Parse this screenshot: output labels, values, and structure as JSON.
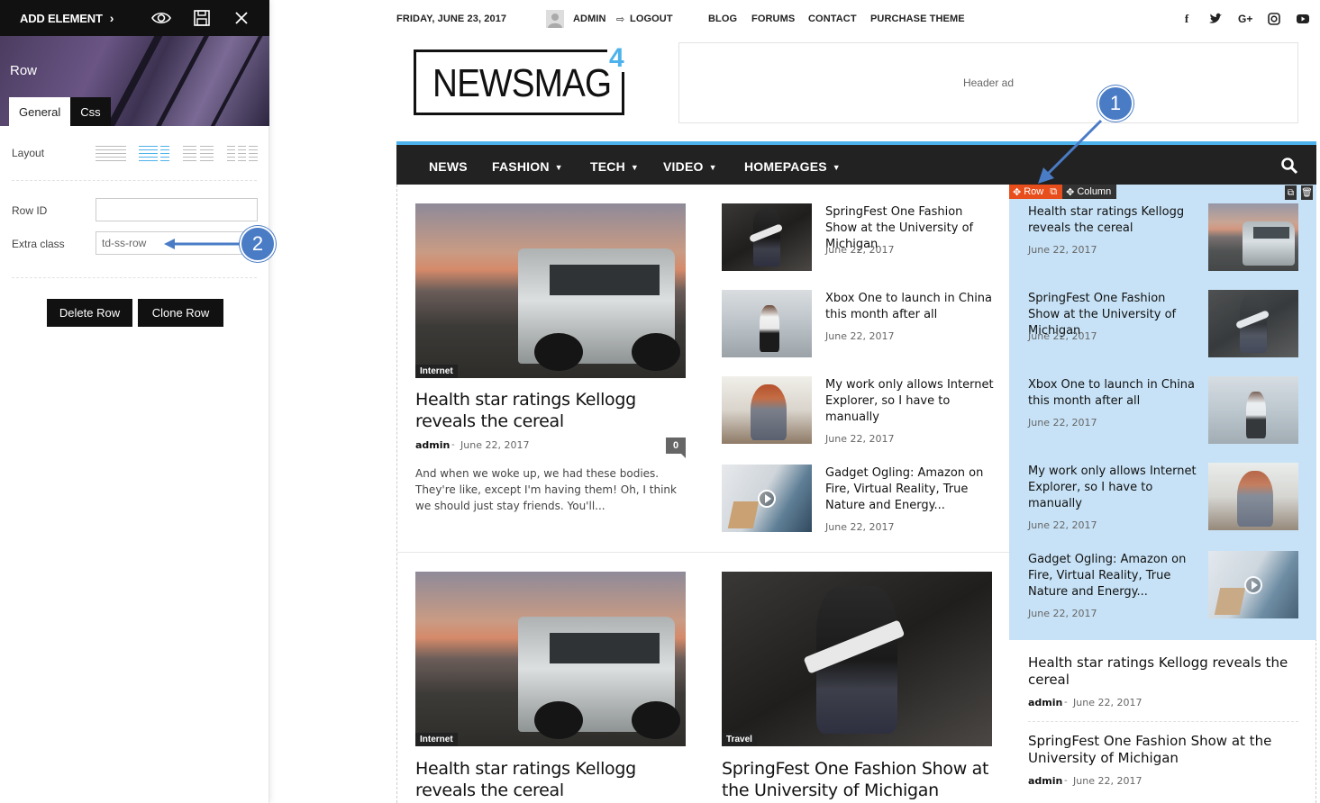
{
  "editor": {
    "add_element": "ADD ELEMENT",
    "title": "Row",
    "tabs": [
      "General",
      "Css"
    ],
    "layout_label": "Layout",
    "row_id_label": "Row ID",
    "row_id_value": "",
    "extra_class_label": "Extra class",
    "extra_class_value": "td-ss-row",
    "delete_button": "Delete Row",
    "clone_button": "Clone Row",
    "accent_color": "#4a7cc6"
  },
  "callouts": [
    "1",
    "2"
  ],
  "site": {
    "date": "FRIDAY, JUNE 23, 2017",
    "user": "ADMIN",
    "logout": "LOGOUT",
    "top_links": [
      "BLOG",
      "FORUMS",
      "CONTACT",
      "PURCHASE THEME"
    ],
    "social_icons": [
      "facebook-icon",
      "twitter-icon",
      "google-plus-icon",
      "instagram-icon",
      "youtube-icon"
    ],
    "logo": "NEWSMAG",
    "logo_sup": "4",
    "header_ad": "Header ad",
    "nav": [
      "NEWS",
      "FASHION",
      "TECH",
      "VIDEO",
      "HOMEPAGES"
    ],
    "accent_color": "#4db2ec"
  },
  "featured": {
    "category": "Internet",
    "title": "Health star ratings Kellogg reveals the cereal",
    "author": "admin",
    "date": "June 22, 2017",
    "comments": "0",
    "excerpt": "And when we woke up, we had these bodies. They're like, except I'm having them! Oh, I think we should just stay friends. You'll..."
  },
  "middle_list": [
    {
      "title": "SpringFest One Fashion Show at the University of Michigan",
      "date": "June 22, 2017"
    },
    {
      "title": "Xbox One to launch in China this month after all",
      "date": "June 22, 2017"
    },
    {
      "title": "My work only allows Internet Explorer, so I have to manually",
      "date": "June 22, 2017"
    },
    {
      "title": "Gadget Ogling: Amazon on Fire, Virtual Reality, True Nature and Energy...",
      "date": "June 22, 2017"
    }
  ],
  "builder_bar": {
    "row": "Row",
    "column": "Column"
  },
  "right_list": [
    {
      "title": "Health star ratings Kellogg reveals the cereal",
      "date": "June 22, 2017"
    },
    {
      "title": "SpringFest One Fashion Show at the University of Michigan",
      "date": "June 22, 2017"
    },
    {
      "title": "Xbox One to launch in China this month after all",
      "date": "June 22, 2017"
    },
    {
      "title": "My work only allows Internet Explorer, so I have to manually",
      "date": "June 22, 2017"
    },
    {
      "title": "Gadget Ogling: Amazon on Fire, Virtual Reality, True Nature and Energy...",
      "date": "June 22, 2017"
    }
  ],
  "right_bottom": [
    {
      "title": "Health star ratings Kellogg reveals the cereal",
      "author": "admin",
      "date": "June 22, 2017"
    },
    {
      "title": "SpringFest One Fashion Show at the University of Michigan",
      "author": "admin",
      "date": "June 22, 2017"
    }
  ],
  "second_row": [
    {
      "category": "Internet",
      "title": "Health star ratings Kellogg reveals the cereal"
    },
    {
      "category": "Travel",
      "title": "SpringFest One Fashion Show at the University of Michigan"
    }
  ],
  "sep": "-"
}
